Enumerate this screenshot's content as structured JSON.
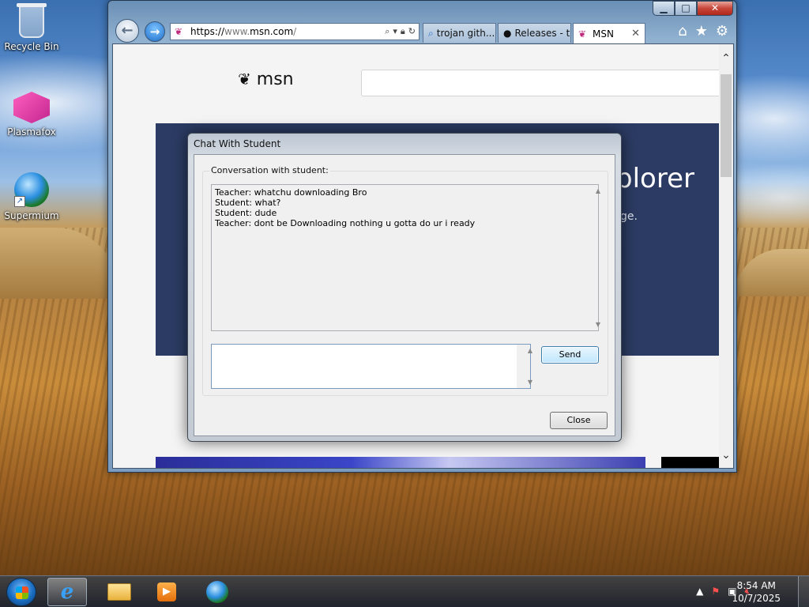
{
  "desktop": {
    "icons": [
      {
        "label": "Recycle Bin",
        "icon": "recycle-bin-icon"
      },
      {
        "label": "Plasmafox",
        "icon": "plasmafox-icon"
      },
      {
        "label": "Supermium",
        "icon": "supermium-icon"
      }
    ]
  },
  "browser": {
    "address": {
      "scheme": "https://",
      "host_prefix": "www.",
      "host": "msn.com",
      "path": "/"
    },
    "tabs": [
      {
        "label": "trojan gith...",
        "icon": "search-icon"
      },
      {
        "label": "Releases - t...",
        "icon": "github-icon"
      },
      {
        "label": "MSN",
        "icon": "msn-icon"
      }
    ],
    "page": {
      "logo_text": "msn",
      "banner_title": "plorer",
      "banner_subtitle": "ge."
    }
  },
  "dialog": {
    "title": "Chat With Student",
    "group_label": "Conversation with student:",
    "messages": [
      "Teacher: whatchu downloading Bro",
      "Student: what?",
      "Student: dude",
      "Teacher: dont be Downloading nothing u gotta do ur i ready"
    ],
    "input_value": "",
    "send_label": "Send",
    "close_label": "Close"
  },
  "taskbar": {
    "apps": [
      {
        "name": "Internet Explorer",
        "icon": "ie-icon",
        "active": true
      },
      {
        "name": "Windows Explorer",
        "icon": "folder-icon",
        "active": false
      },
      {
        "name": "Windows Media Player",
        "icon": "media-player-icon",
        "active": false
      },
      {
        "name": "Supermium",
        "icon": "supermium-icon",
        "active": false
      }
    ],
    "clock": {
      "time": "8:54 AM",
      "date": "10/7/2025"
    }
  },
  "colors": {
    "banner_bg": "#2b3b63",
    "send_button": "#bee6fd",
    "accent": "#1d6ec9"
  }
}
